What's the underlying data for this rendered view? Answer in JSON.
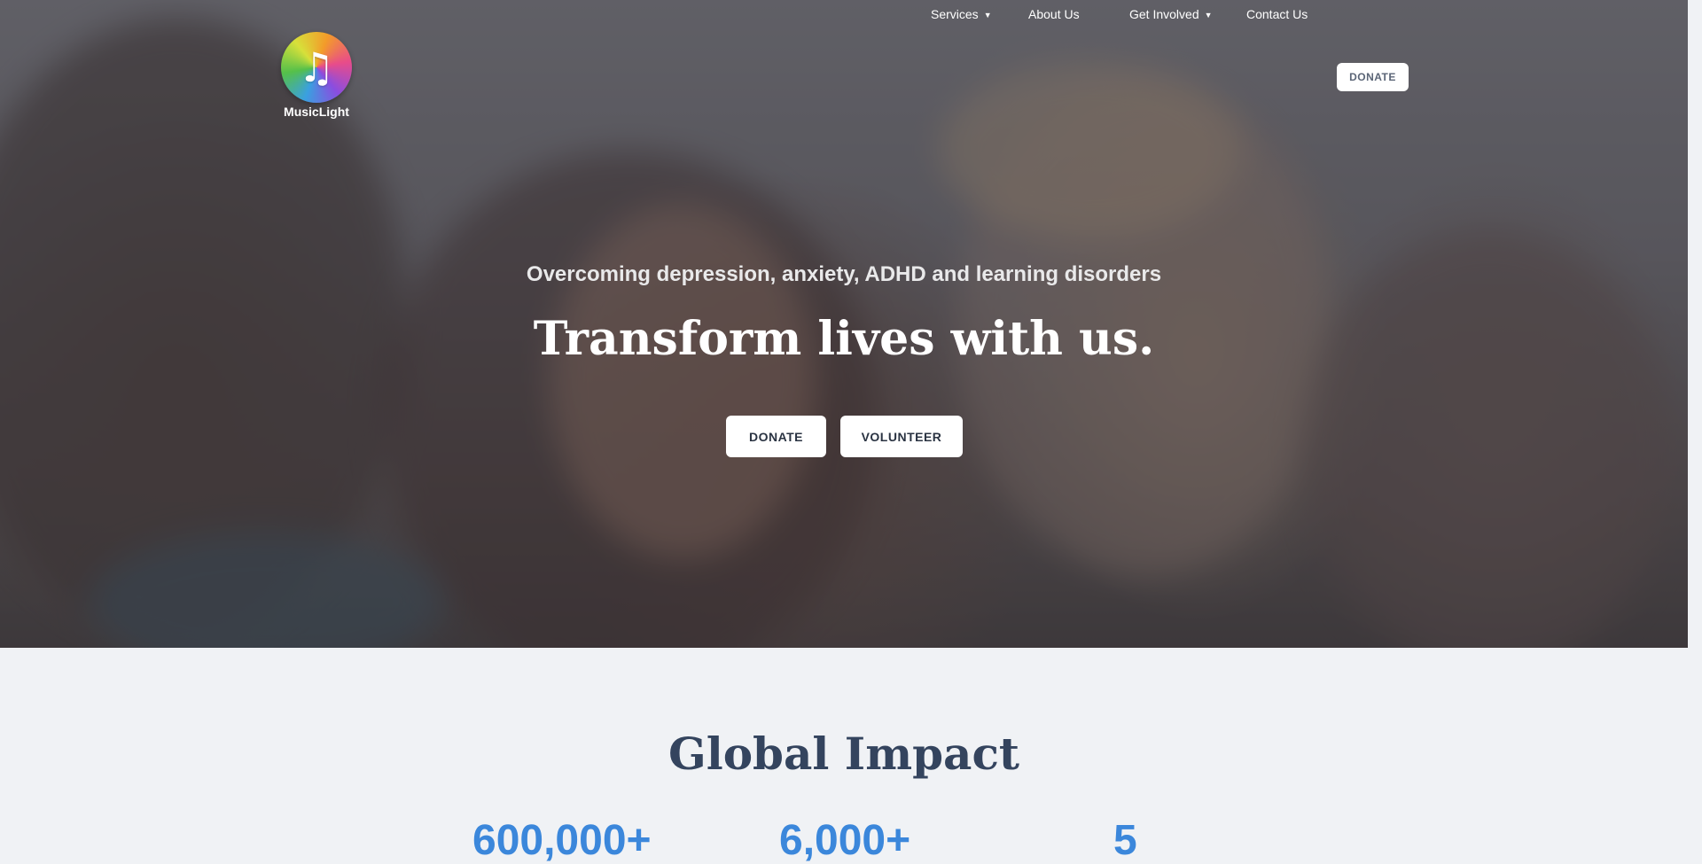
{
  "brand": {
    "name": "MusicLight",
    "logo_icon": "music-note-icon",
    "logo_glyph": "♫"
  },
  "nav": {
    "items": [
      {
        "label": "Services",
        "has_dropdown": true
      },
      {
        "label": "About Us",
        "has_dropdown": false
      },
      {
        "label": "Get Involved",
        "has_dropdown": true
      },
      {
        "label": "Contact Us",
        "has_dropdown": false
      }
    ],
    "donate_label": "DONATE",
    "chevron": "⌄"
  },
  "hero": {
    "subtitle": "Overcoming depression, anxiety, ADHD and learning disorders",
    "title": "Transform lives with us.",
    "donate_label": "DONATE",
    "volunteer_label": "VOLUNTEER"
  },
  "impact": {
    "title": "Global Impact",
    "stats": [
      "600,000+",
      "6,000+",
      "5"
    ]
  },
  "colors": {
    "accent": "#3b87db",
    "heading": "#34445e",
    "section_bg": "#f0f2f5"
  }
}
